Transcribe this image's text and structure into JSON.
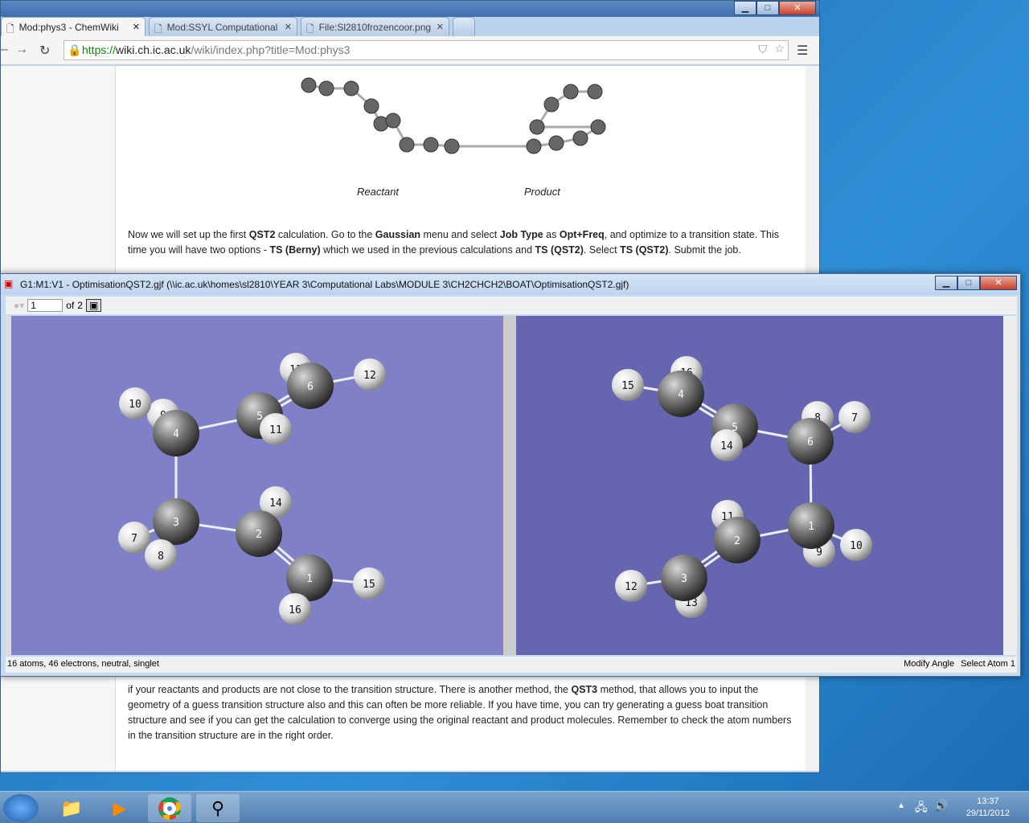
{
  "browser": {
    "tabs": [
      {
        "label": "Mod:phys3 - ChemWiki",
        "active": true
      },
      {
        "label": "Mod:SSYL Computational",
        "active": false
      },
      {
        "label": "File:Sl2810frozencoor.png",
        "active": false
      }
    ],
    "url": {
      "scheme": "https://",
      "host": "wiki.ch.ic.ac.uk",
      "path": "/wiki/index.php?title=Mod:phys3"
    }
  },
  "page": {
    "captions": {
      "reactant": "Reactant",
      "product": "Product"
    },
    "para1": [
      {
        "t": "Now we will set up the first ",
        "b": false
      },
      {
        "t": "QST2",
        "b": true
      },
      {
        "t": " calculation. Go to the ",
        "b": false
      },
      {
        "t": "Gaussian",
        "b": true
      },
      {
        "t": " menu and select ",
        "b": false
      },
      {
        "t": "Job Type",
        "b": true
      },
      {
        "t": " as ",
        "b": false
      },
      {
        "t": "Opt+Freq",
        "b": true
      },
      {
        "t": ", and optimize to a transition state. This time you will have two options - ",
        "b": false
      },
      {
        "t": "TS (Berny)",
        "b": true
      },
      {
        "t": " which we used in the previous calculations and ",
        "b": false
      },
      {
        "t": "TS (QST2)",
        "b": true
      },
      {
        "t": ". Select ",
        "b": false
      },
      {
        "t": "TS (QST2)",
        "b": true
      },
      {
        "t": ". Submit the job.",
        "b": false
      }
    ],
    "para2": [
      {
        "t": "if your reactants and products are not close to the transition structure. There is another method, the ",
        "b": false
      },
      {
        "t": "QST3",
        "b": true
      },
      {
        "t": " method, that allows you to input the geometry of a guess transition structure also and this can often be more reliable. If you have time, you can try generating a guess boat transition structure and see if you can get the calculation to converge using the original reactant and product molecules. Remember to check the atom numbers in the transition structure are in the right order.",
        "b": false
      }
    ]
  },
  "gaussview": {
    "title": "G1:M1:V1 - OptimisationQST2.gjf (\\\\ic.ac.uk\\homes\\sl2810\\YEAR 3\\Computational Labs\\MODULE 3\\CH2CHCH2\\BOAT\\OptimisationQST2.gjf)",
    "molecule_index": "1",
    "of_label": "of",
    "molecule_count": "2",
    "status_left": "16 atoms, 46 electrons, neutral, singlet",
    "status_mode": "Modify Angle",
    "status_action": "Select Atom 1",
    "left_bg": "#8080c8",
    "right_bg": "#6666b0",
    "left_atoms": [
      "13",
      "9",
      "6",
      "12",
      "10",
      "4",
      "5",
      "11",
      "14",
      "3",
      "7",
      "8",
      "2",
      "1",
      "16",
      "15"
    ],
    "right_atoms": [
      "16",
      "8",
      "15",
      "4",
      "5",
      "14",
      "7",
      "6",
      "11",
      "9",
      "2",
      "1",
      "10",
      "13",
      "3",
      "12"
    ]
  },
  "taskbar": {
    "time": "13:37",
    "date": "29/11/2012"
  }
}
